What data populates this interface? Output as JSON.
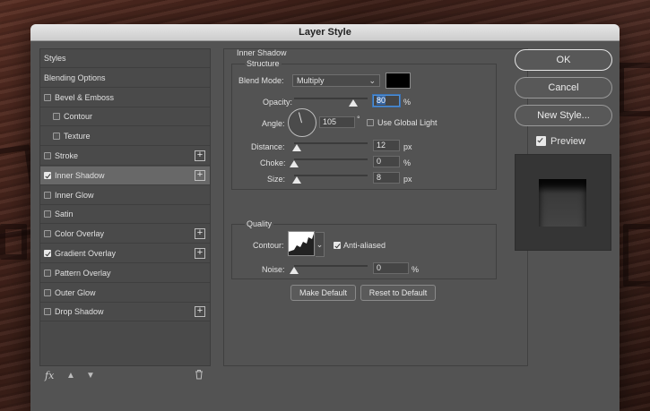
{
  "window": {
    "title": "Layer Style"
  },
  "styles_panel": {
    "items": [
      {
        "label": "Styles",
        "checkbox": false,
        "checked": false,
        "plus": false,
        "selected": false
      },
      {
        "label": "Blending Options",
        "checkbox": false,
        "checked": false,
        "plus": false,
        "selected": false
      },
      {
        "label": "Bevel & Emboss",
        "checkbox": true,
        "checked": false,
        "plus": false,
        "selected": false
      },
      {
        "label": "Contour",
        "checkbox": true,
        "checked": false,
        "plus": false,
        "selected": false
      },
      {
        "label": "Texture",
        "checkbox": true,
        "checked": false,
        "plus": false,
        "selected": false
      },
      {
        "label": "Stroke",
        "checkbox": true,
        "checked": false,
        "plus": true,
        "selected": false
      },
      {
        "label": "Inner Shadow",
        "checkbox": true,
        "checked": true,
        "plus": true,
        "selected": true
      },
      {
        "label": "Inner Glow",
        "checkbox": true,
        "checked": false,
        "plus": false,
        "selected": false
      },
      {
        "label": "Satin",
        "checkbox": true,
        "checked": false,
        "plus": false,
        "selected": false
      },
      {
        "label": "Color Overlay",
        "checkbox": true,
        "checked": false,
        "plus": true,
        "selected": false
      },
      {
        "label": "Gradient Overlay",
        "checkbox": true,
        "checked": true,
        "plus": true,
        "selected": false
      },
      {
        "label": "Pattern Overlay",
        "checkbox": true,
        "checked": false,
        "plus": false,
        "selected": false
      },
      {
        "label": "Outer Glow",
        "checkbox": true,
        "checked": false,
        "plus": false,
        "selected": false
      },
      {
        "label": "Drop Shadow",
        "checkbox": true,
        "checked": false,
        "plus": true,
        "selected": false
      }
    ],
    "footer": {
      "fx": "fx",
      "up_icon": "arrow-up-icon",
      "down_icon": "arrow-down-icon",
      "trash_icon": "trash-icon"
    }
  },
  "inner_shadow": {
    "section_title": "Inner Shadow",
    "structure": {
      "title": "Structure",
      "blend_mode_label": "Blend Mode:",
      "blend_mode_value": "Multiply",
      "blend_color": "#000000",
      "opacity_label": "Opacity:",
      "opacity_value": "80",
      "opacity_unit": "%",
      "opacity_level": 0.8,
      "angle_label": "Angle:",
      "angle_value": "105",
      "angle_unit": "°",
      "angle_degrees": 105,
      "global_light_label": "Use Global Light",
      "global_light_checked": false,
      "distance_label": "Distance:",
      "distance_value": "12",
      "distance_unit": "px",
      "distance_level": 0.04,
      "choke_label": "Choke:",
      "choke_value": "0",
      "choke_unit": "%",
      "choke_level": 0.0,
      "size_label": "Size:",
      "size_value": "8",
      "size_unit": "px",
      "size_level": 0.033
    },
    "quality": {
      "title": "Quality",
      "contour_label": "Contour:",
      "anti_aliased_label": "Anti-aliased",
      "anti_aliased_checked": true,
      "noise_label": "Noise:",
      "noise_value": "0",
      "noise_unit": "%",
      "noise_level": 0.0
    },
    "buttons": {
      "make_default": "Make Default",
      "reset_default": "Reset to Default"
    }
  },
  "actions": {
    "ok": "OK",
    "cancel": "Cancel",
    "new_style": "New Style...",
    "preview_label": "Preview",
    "preview_checked": true
  }
}
